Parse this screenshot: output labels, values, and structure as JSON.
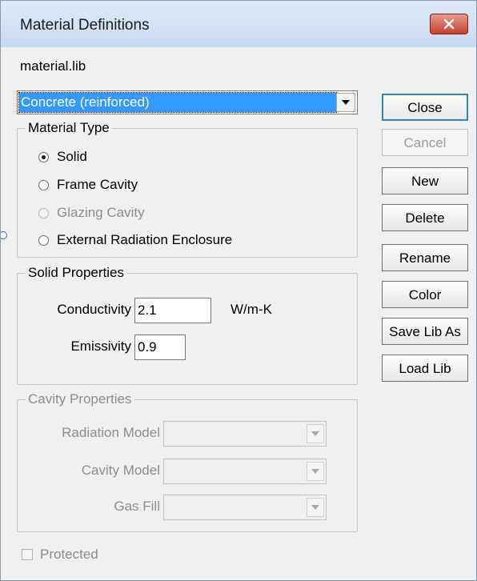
{
  "window": {
    "title": "Material Definitions"
  },
  "library": {
    "file_name": "material.lib"
  },
  "material_select": {
    "selected": "Concrete (reinforced)"
  },
  "material_type": {
    "legend": "Material Type",
    "options": [
      {
        "label": "Solid",
        "checked": true,
        "enabled": true
      },
      {
        "label": "Frame Cavity",
        "checked": false,
        "enabled": true
      },
      {
        "label": "Glazing Cavity",
        "checked": false,
        "enabled": false
      },
      {
        "label": "External Radiation Enclosure",
        "checked": false,
        "enabled": true
      }
    ]
  },
  "solid_properties": {
    "legend": "Solid Properties",
    "conductivity_label": "Conductivity",
    "conductivity_value": "2.1",
    "conductivity_unit": "W/m-K",
    "emissivity_label": "Emissivity",
    "emissivity_value": "0.9"
  },
  "cavity_properties": {
    "legend": "Cavity Properties",
    "radiation_model_label": "Radiation Model",
    "cavity_model_label": "Cavity Model",
    "gas_fill_label": "Gas Fill"
  },
  "protected": {
    "label": "Protected",
    "checked": false
  },
  "buttons": {
    "close": "Close",
    "cancel": "Cancel",
    "new": "New",
    "delete": "Delete",
    "rename": "Rename",
    "color": "Color",
    "save_lib_as": "Save Lib As",
    "load_lib": "Load Lib"
  },
  "icons": {
    "window_close": "close-icon",
    "dropdown": "chevron-down-icon"
  },
  "colors": {
    "selection": "#3399ff",
    "close_button": "#c8412c",
    "title_bar": "#dfeaf7"
  }
}
